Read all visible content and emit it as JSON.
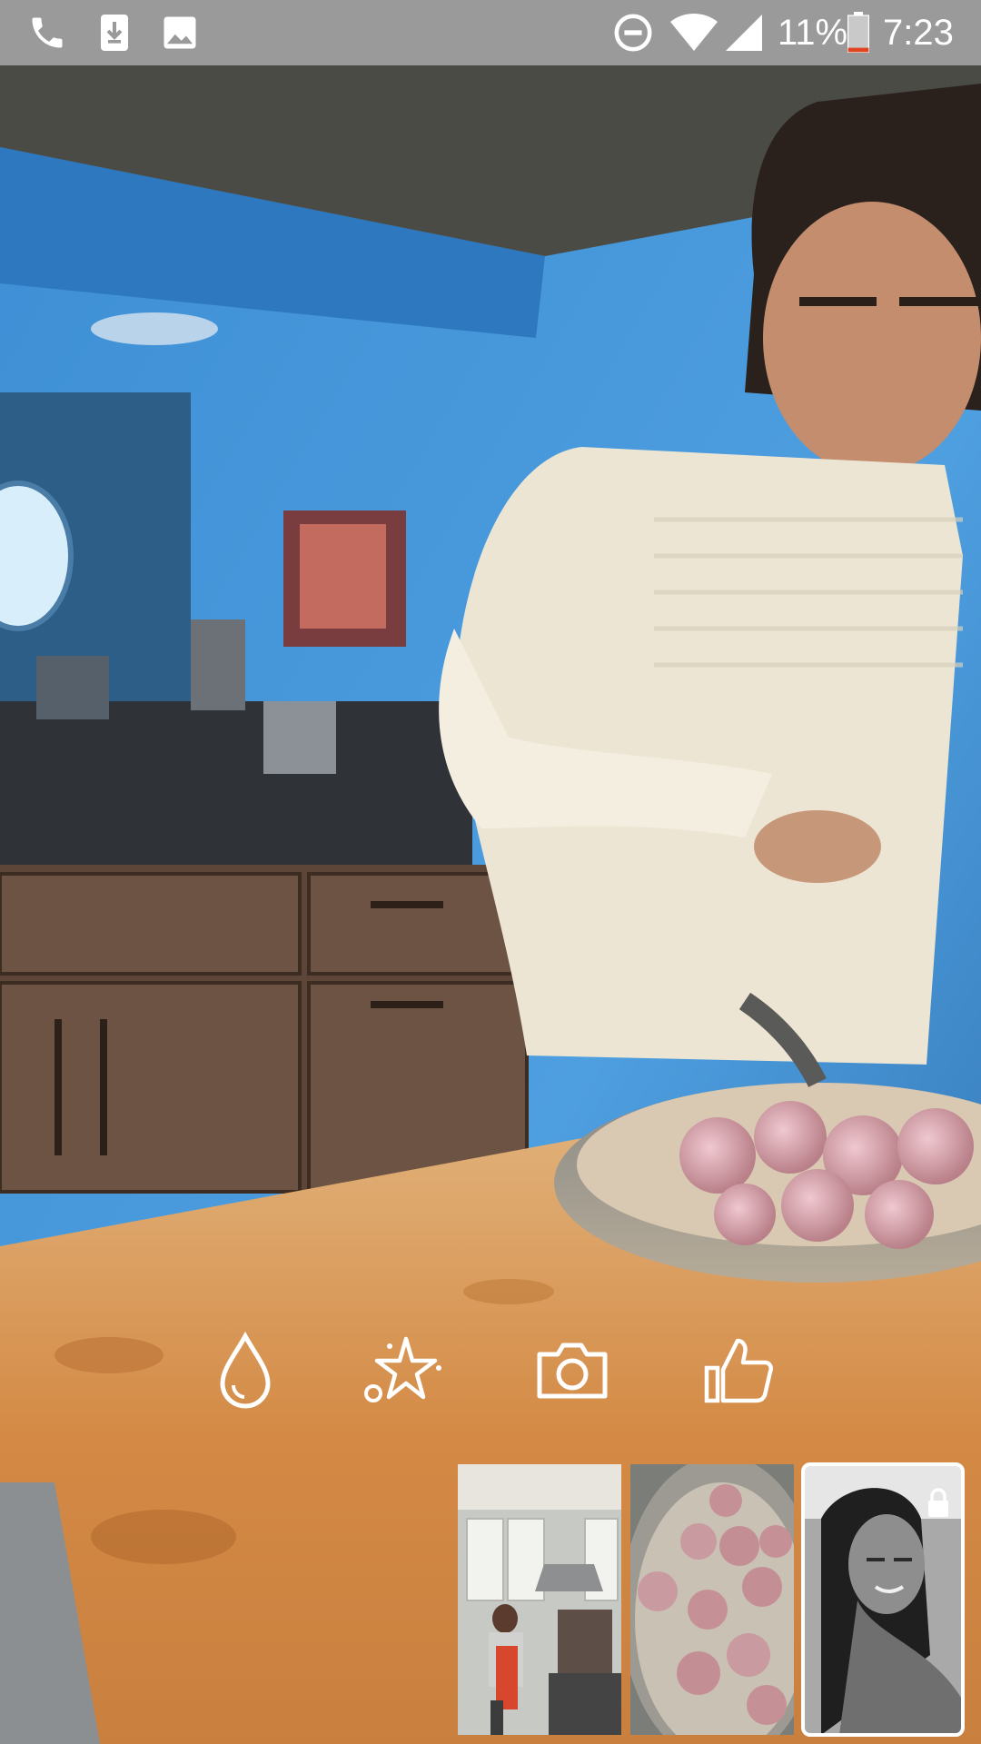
{
  "status_bar": {
    "battery": "11%",
    "time": "7:23",
    "icons": [
      "phone-icon",
      "download-icon",
      "image-icon",
      "do-not-disturb-icon",
      "wifi-icon",
      "signal-icon",
      "battery-icon"
    ]
  },
  "video": {
    "description_icon": "live-video-frame"
  },
  "actions": {
    "items": [
      {
        "name": "filter",
        "icon": "droplet-icon"
      },
      {
        "name": "effects",
        "icon": "magic-star-icon"
      },
      {
        "name": "camera",
        "icon": "camera-icon"
      },
      {
        "name": "like",
        "icon": "thumbs-up-icon"
      }
    ]
  },
  "thumbnails": {
    "items": [
      {
        "name": "kitchen-thumbnail"
      },
      {
        "name": "meatballs-thumbnail"
      },
      {
        "name": "portrait-thumbnail",
        "locked": true,
        "lock_icon": "lock-icon"
      }
    ]
  },
  "colors": {
    "status_bar": "#9a9a9a",
    "wall_blue": "#3b86c8",
    "counter_wood": "#d79a52",
    "battery_low": "#e0451f"
  }
}
